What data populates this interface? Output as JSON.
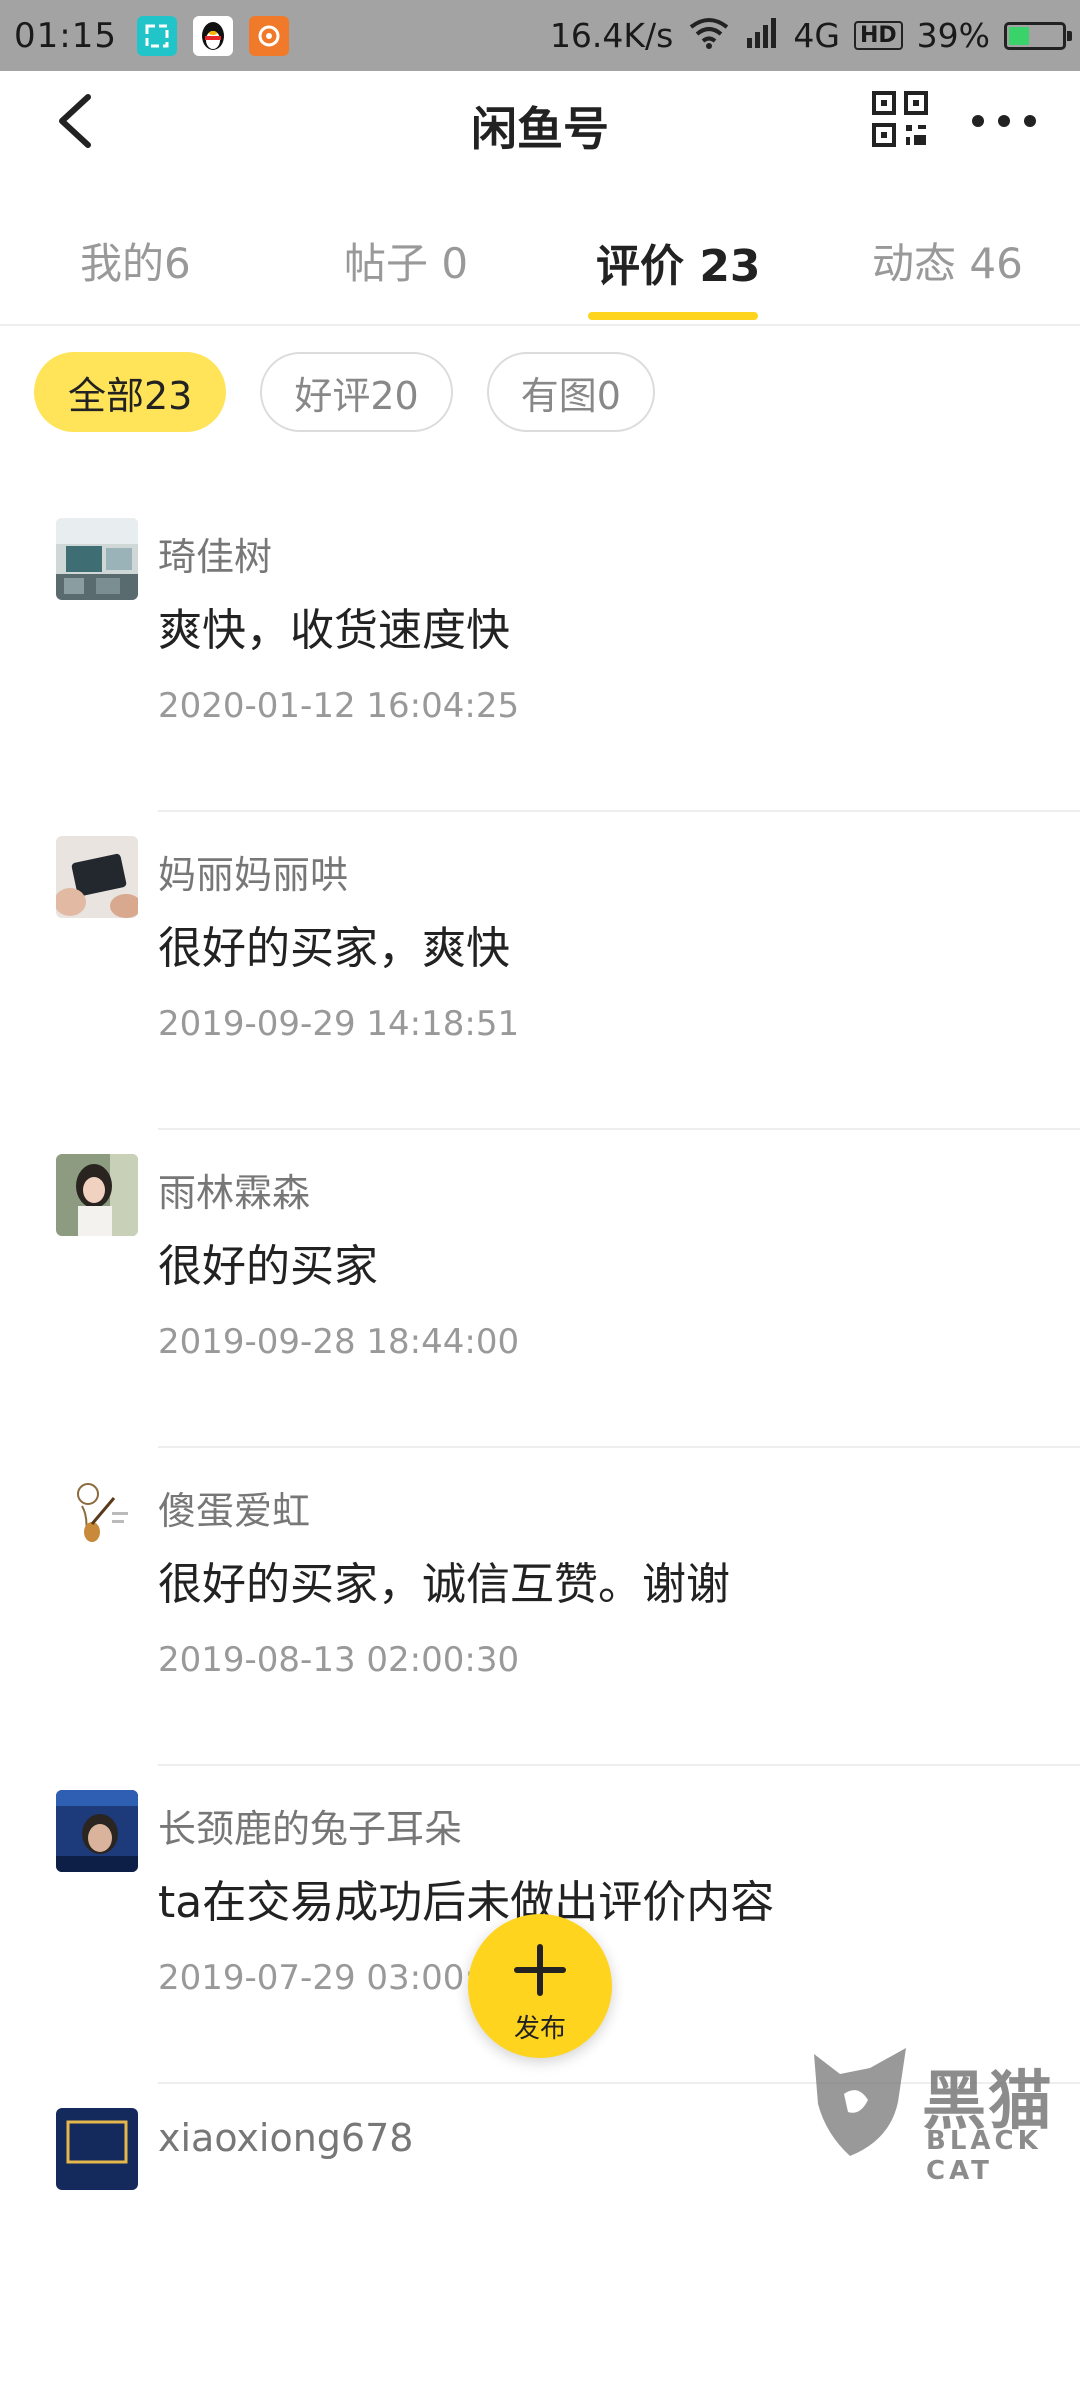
{
  "status_bar": {
    "time": "01:15",
    "speed": "16.4K/s",
    "network": "4G",
    "hd": "HD",
    "battery_percent": "39%",
    "battery_level": 0.39
  },
  "nav": {
    "title": "闲鱼号"
  },
  "tabs": [
    {
      "label": "我的6"
    },
    {
      "label": "帖子 0"
    },
    {
      "label": "评价 23"
    },
    {
      "label": "动态 46"
    }
  ],
  "filters": [
    {
      "label": "全部23"
    },
    {
      "label": "好评20"
    },
    {
      "label": "有图0"
    }
  ],
  "reviews": [
    {
      "name": "琦佳树",
      "text": "爽快，收货速度快",
      "time": "2020-01-12 16:04:25"
    },
    {
      "name": "妈丽妈丽哄",
      "text": "很好的买家，爽快",
      "time": "2019-09-29 14:18:51"
    },
    {
      "name": "雨林霖森",
      "text": "很好的买家",
      "time": "2019-09-28 18:44:00"
    },
    {
      "name": "傻蛋爱虹",
      "text": "很好的买家，诚信互赞。谢谢",
      "time": "2019-08-13 02:00:30"
    },
    {
      "name": "长颈鹿的兔子耳朵",
      "text": "ta在交易成功后未做出评价内容",
      "time": "2019-07-29 03:00:0"
    },
    {
      "name": "xiaoxiong678",
      "text": "",
      "time": ""
    }
  ],
  "fab": {
    "label": "发布"
  },
  "watermark": {
    "text": "黑猫",
    "sub": "BLACK CAT"
  },
  "colors": {
    "accent": "#ffd41f",
    "chip_active": "#ffe45a"
  }
}
